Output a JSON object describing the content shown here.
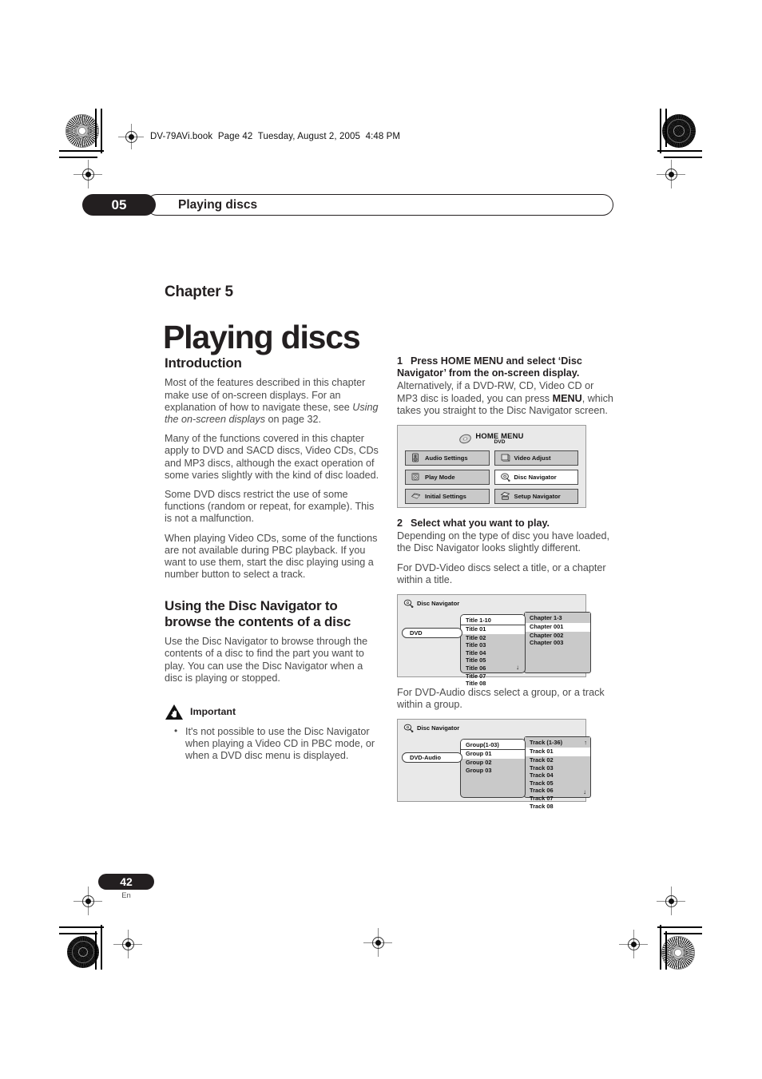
{
  "book_header": "DV-79AVi.book  Page 42  Tuesday, August 2, 2005  4:48 PM",
  "chapter_bar": {
    "number": "05",
    "title": "Playing discs"
  },
  "title_block": {
    "kicker": "Chapter 5",
    "title": "Playing discs"
  },
  "left_column": {
    "intro_heading": "Introduction",
    "intro_paragraphs": [
      "Most of the features described in this chapter make use of on-screen displays. For an explanation of how to navigate these, see ",
      "Many of the functions covered in this chapter apply to DVD and SACD discs, Video CDs, CDs and MP3 discs, although the exact operation of some varies slightly with the kind of disc loaded.",
      "Some DVD discs restrict the use of some functions (random or repeat, for example). This is not a malfunction.",
      "When playing Video CDs, some of the functions are not available during PBC playback. If you want to use them, start the disc playing using a number button to select a track."
    ],
    "intro_italic_ref": "Using the on-screen displays",
    "intro_ref_tail": " on page 32.",
    "navigator_heading": "Using the Disc Navigator to browse the contents of a disc",
    "navigator_paragraph": "Use the Disc Navigator to browse through the contents of a disc to find the part you want to play. You can use the Disc Navigator when a disc is playing or stopped.",
    "important_label": "Important",
    "important_bullets": [
      "It's not possible to use the Disc Navigator when playing a Video CD in PBC mode, or when a DVD disc menu is displayed."
    ]
  },
  "right_column": {
    "step1": {
      "num": "1",
      "heading": "Press HOME MENU and select ‘Disc Navigator’ from the on-screen display.",
      "body_pre": "Alternatively, if a DVD-RW, CD, Video CD or MP3 disc is loaded, you can press ",
      "body_bold": "MENU",
      "body_post": ", which takes you straight to the Disc Navigator screen."
    },
    "home_menu": {
      "title": "HOME MENU",
      "subtitle": "DVD",
      "buttons": [
        {
          "label": "Audio Settings",
          "icon": "speaker-icon",
          "selected": false
        },
        {
          "label": "Video Adjust",
          "icon": "monitor-icon",
          "selected": false
        },
        {
          "label": "Play Mode",
          "icon": "play-mode-icon",
          "selected": false
        },
        {
          "label": "Disc Navigator",
          "icon": "disc-navigator-icon",
          "selected": true
        },
        {
          "label": "Initial Settings",
          "icon": "settings-icon",
          "selected": false
        },
        {
          "label": "Setup Navigator",
          "icon": "setup-navigator-icon",
          "selected": false
        }
      ]
    },
    "step2": {
      "num": "2",
      "heading": "Select what you want to play.",
      "body1": "Depending on the type of disc you have loaded, the Disc Navigator looks slightly different.",
      "body2": "For DVD-Video discs select a title, or a chapter within a title."
    },
    "nav_video": {
      "header": "Disc Navigator",
      "disc_tag": "DVD",
      "mid_header": "Title 1-10",
      "mid_items": [
        "Title 01",
        "Title 02",
        "Title 03",
        "Title 04",
        "Title 05",
        "Title 06",
        "Title 07",
        "Title 08"
      ],
      "mid_selected": "Title 01",
      "right_header": "Chapter 1-3",
      "right_items": [
        "Chapter 001",
        "Chapter 002",
        "Chapter 003"
      ],
      "right_selected": "Chapter 001",
      "mid_scroll_down": "↓",
      "right_scroll_up": "",
      "right_scroll_down": ""
    },
    "step3_text": "For DVD-Audio discs select a group, or a track within a group.",
    "nav_audio": {
      "header": "Disc Navigator",
      "disc_tag": "DVD-Audio",
      "mid_header": "Group(1-03)",
      "mid_items": [
        "Group 01",
        "Group 02",
        "Group 03"
      ],
      "mid_selected": "Group 01",
      "right_header": "Track (1-36)",
      "right_items": [
        "Track 01",
        "Track 02",
        "Track 03",
        "Track 04",
        "Track 05",
        "Track 06",
        "Track 07",
        "Track 08"
      ],
      "right_selected": "Track 01",
      "right_scroll_up": "↑",
      "right_scroll_down": "↓"
    }
  },
  "footer": {
    "page_number": "42",
    "language": "En"
  }
}
